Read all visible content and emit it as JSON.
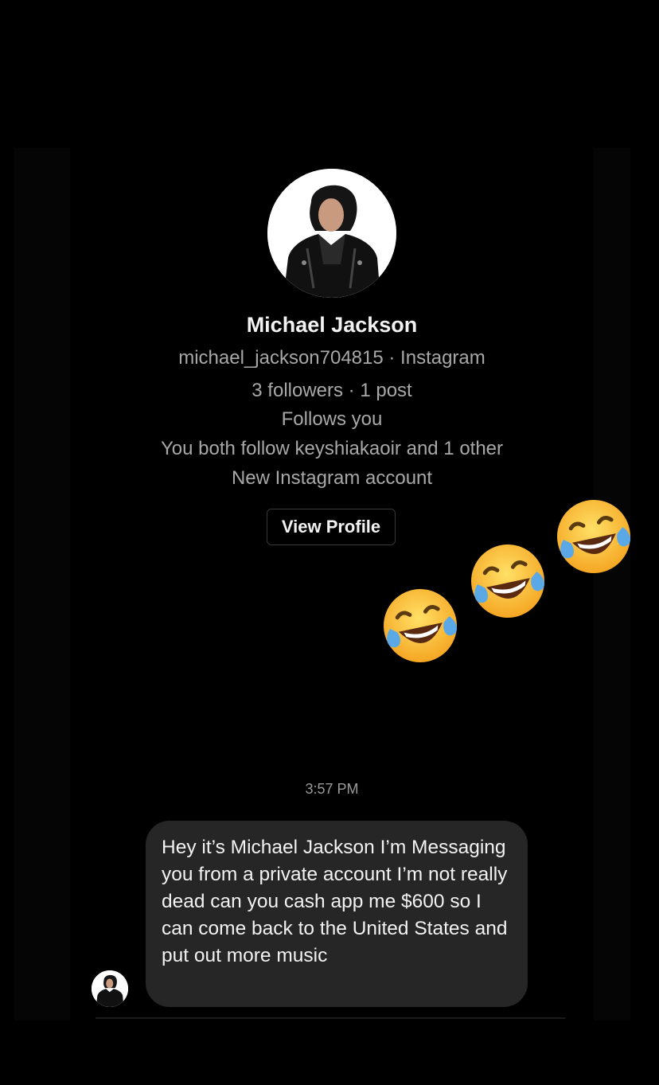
{
  "profile": {
    "name": "Michael Jackson",
    "handle_line": "michael_jackson704815 · Instagram",
    "stats_line": "3 followers · 1 post",
    "follows_line": "Follows you",
    "mutual_line": "You both follow keyshiakaoir and 1 other",
    "account_note": "New Instagram account",
    "view_profile_label": "View Profile",
    "avatar_icon": "profile-photo"
  },
  "thread": {
    "timestamp": "3:57 PM",
    "message_text": "Hey it’s Michael Jackson I’m Messaging you from a private account I’m not really dead can you cash app me $600 so I can come back to the United States and put out more music",
    "sender_avatar_icon": "profile-photo"
  },
  "overlay": {
    "emoji_icon": "face-with-tears-of-joy",
    "emoji_count": 3
  },
  "colors": {
    "background": "#000000",
    "bubble": "#262626",
    "primary_text": "#f2f2f2",
    "secondary_text": "#a8a8a8"
  }
}
